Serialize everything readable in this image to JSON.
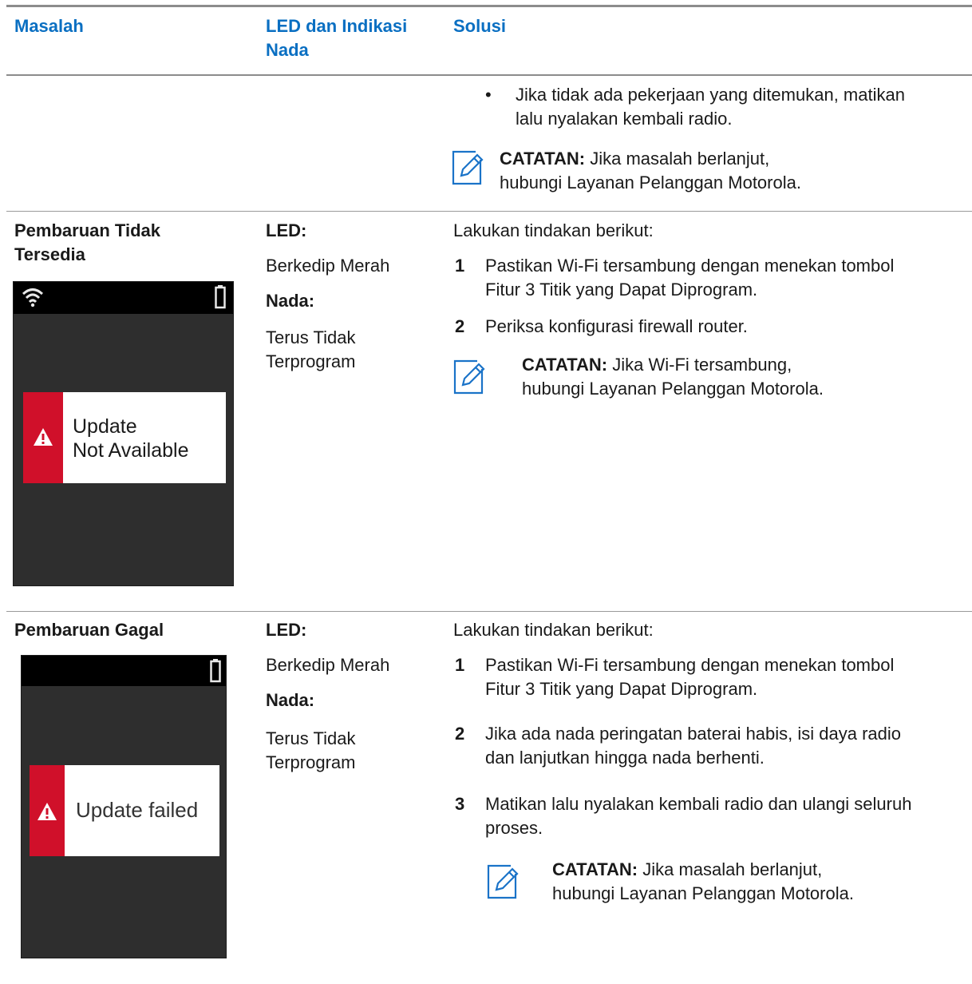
{
  "table": {
    "headers": {
      "problem": "Masalah",
      "led": "LED dan Indikasi Nada",
      "solution": "Solusi"
    }
  },
  "row0": {
    "bullet": "Jika tidak ada pekerjaan yang ditemukan, matikan lalu nyalakan kembali radio.",
    "note_label": "CATATAN:",
    "note_text": "Jika masalah berlanjut, hubungi Layanan Pelanggan Motorola."
  },
  "row1": {
    "title": "Pembaruan Tidak Tersedia",
    "screen_message_line1": "Update",
    "screen_message_line2": "Not Available",
    "led_label": "LED:",
    "led_value": "Berkedip Merah",
    "tone_label": "Nada:",
    "tone_value": "Terus Tidak Terprogram",
    "intro": "Lakukan tindakan berikut:",
    "steps": [
      {
        "num": "1",
        "text": "Pastikan Wi-Fi tersambung dengan menekan tombol Fitur 3 Titik yang Dapat Diprogram."
      },
      {
        "num": "2",
        "text": "Periksa konfigurasi firewall router."
      }
    ],
    "note_label": "CATATAN:",
    "note_text": "Jika Wi-Fi tersambung, hubungi Layanan Pelanggan Motorola."
  },
  "row2": {
    "title": "Pembaruan Gagal",
    "screen_message": "Update failed",
    "led_label": "LED:",
    "led_value": "Berkedip Merah",
    "tone_label": "Nada:",
    "tone_value": "Terus Tidak Terprogram",
    "intro": "Lakukan tindakan berikut:",
    "steps": [
      {
        "num": "1",
        "text": "Pastikan Wi-Fi tersambung dengan menekan tombol Fitur 3 Titik yang Dapat Diprogram."
      },
      {
        "num": "2",
        "text": "Jika ada nada peringatan baterai habis, isi daya radio dan lanjutkan hingga nada berhenti."
      },
      {
        "num": "3",
        "text": "Matikan lalu nyalakan kembali radio dan ulangi seluruh proses."
      }
    ],
    "note_label": "CATATAN:",
    "note_text": "Jika masalah berlanjut, hubungi Layanan Pelanggan Motorola."
  },
  "icons": {
    "note": "pencil-note-icon",
    "wifi": "wifi-icon",
    "battery": "battery-icon",
    "warning": "warning-triangle-icon"
  },
  "colors": {
    "header_text": "#0a6fc2",
    "note_icon": "#1a73c8",
    "alert_red": "#d0102a",
    "screen_bg": "#2e2e2e"
  }
}
